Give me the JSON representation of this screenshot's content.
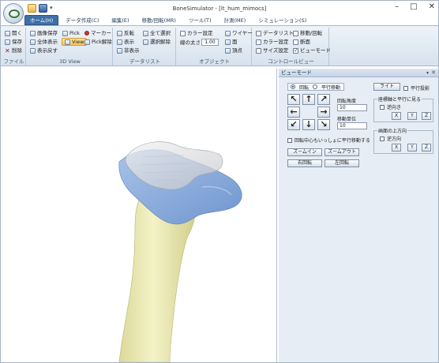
{
  "window": {
    "title": "BoneSimulator - [lt_hum_mimocs]",
    "minimize": "–",
    "maximize": "□",
    "close": "✕"
  },
  "qat_arrow": "▾",
  "tabs": [
    {
      "label": "ホーム(H)",
      "active": true
    },
    {
      "label": "データ作成(C)",
      "active": false
    },
    {
      "label": "編集(E)",
      "active": false
    },
    {
      "label": "移動/回転(MR)",
      "active": false
    },
    {
      "label": "ツール(T)",
      "active": false
    },
    {
      "label": "計測(ME)",
      "active": false
    },
    {
      "label": "シミュレーション(S)",
      "active": false
    }
  ],
  "ribbon": {
    "file": {
      "label": "ファイル",
      "open": "開く",
      "save": "保存",
      "delete": "削除"
    },
    "view3d": {
      "label": "3D View",
      "save_image": "画像保存",
      "show_all": "全体表示",
      "restore": "表示戻す",
      "pick": "Pick",
      "view": "View",
      "marker": "マーカー",
      "pick_release": "Pick解除"
    },
    "datalist": {
      "label": "データリスト",
      "invert": "反転",
      "select_all": "全て選択",
      "show": "表示",
      "deselect": "選択解除",
      "hide": "非表示"
    },
    "object": {
      "label": "オブジェクト",
      "color_setting": "カラー設定",
      "line_size_label": "線の太さ",
      "line_size_value": "1.00",
      "wire": "ワイヤー",
      "face": "面",
      "vertex": "頂点"
    },
    "control": {
      "label": "コントロールビュー",
      "datalist": "データリスト",
      "color_setting": "カラー設定",
      "size_setting": "サイズ設定",
      "move_rotate": "移動/回転",
      "section": "断面",
      "view_mode": "ビューモード",
      "checked": [
        false,
        false,
        false,
        false,
        false,
        true
      ]
    }
  },
  "panel": {
    "title": "ビューモード",
    "pin": "▾",
    "close": "✕",
    "radio_rotate": "回転",
    "radio_translate": "平行移動",
    "arrows": [
      "↖",
      "↑",
      "↗",
      "←",
      "",
      "→",
      "↙",
      "↓",
      "↘"
    ],
    "rotate_angle_label": "回転角度",
    "rotate_angle_value": "10",
    "move_unit_label": "移動単位",
    "move_unit_value": "10",
    "together_label": "回転中心もいっしょに平行移動する",
    "zoom_in": "ズームイン",
    "zoom_out": "ズームアウト",
    "rotate_right": "右回転",
    "rotate_left": "左回転",
    "light": "ライト",
    "parallel_projection": "平行投影",
    "axis_group_title": "座標軸と平行に見る",
    "axis_reverse": "逆向き",
    "screen_up_title": "画面の上方向",
    "up_reverse": "逆方向",
    "x": "X",
    "y": "Y",
    "z": "Z"
  },
  "colors": {
    "bone_shaft": "#eeedb4",
    "bone_head": "#8fb2e0",
    "bone_cap": "#d9dadd",
    "tab_active": "#3f6fa8"
  }
}
